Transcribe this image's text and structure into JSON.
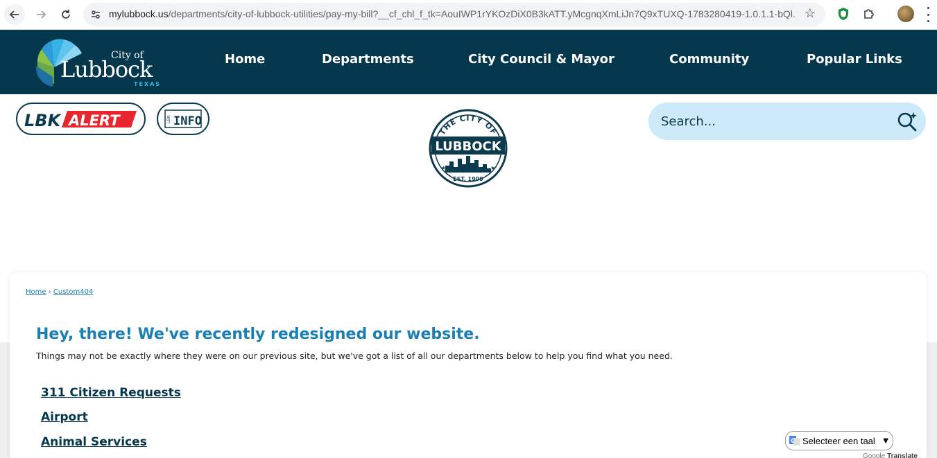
{
  "browser": {
    "url_host": "mylubbock.us",
    "url_rest": "/departments/city-of-lubbock-utilities/pay-my-bill?__cf_chl_f_tk=AouIWP1rYKOzDiX0B3kATT.yMcgnqXmLiJn7Q9xTUXQ-1783280419-1.0.1.1-bQl..."
  },
  "header": {
    "logo_small": "City of",
    "logo_big": "Lubbock",
    "logo_sub": "TEXAS",
    "nav": [
      {
        "label": "Home"
      },
      {
        "label": "Departments"
      },
      {
        "label": "City Council & Mayor"
      },
      {
        "label": "Community"
      },
      {
        "label": "Popular Links"
      }
    ]
  },
  "quicklinks": {
    "alert_prefix": "LBK",
    "alert_word": "ALERT",
    "info_prefix": "LBK",
    "info_word": "INFO"
  },
  "seal": {
    "top_text": "THE CITY OF",
    "name": "LUBBOCK",
    "est": "EST. 1909"
  },
  "search": {
    "placeholder": "Search..."
  },
  "breadcrumb": {
    "home": "Home",
    "separator": "›",
    "current": "Custom404"
  },
  "content": {
    "headline": "Hey, there! We've recently redesigned our website.",
    "subline": "Things may not be exactly where they were on our previous site, but we've got a list of all our departments below to help you find what you need.",
    "departments": [
      {
        "label": "311 Citizen Requests"
      },
      {
        "label": "Airport"
      },
      {
        "label": "Animal Services"
      }
    ]
  },
  "translate": {
    "label": "Selecteer een taal",
    "powered_by": "Google",
    "powered_word": "Translate"
  },
  "colors": {
    "header_bg": "#05384d",
    "accent_blue": "#1a7fb3",
    "search_bg": "#cdeafa",
    "alert_red": "#e8262d"
  }
}
